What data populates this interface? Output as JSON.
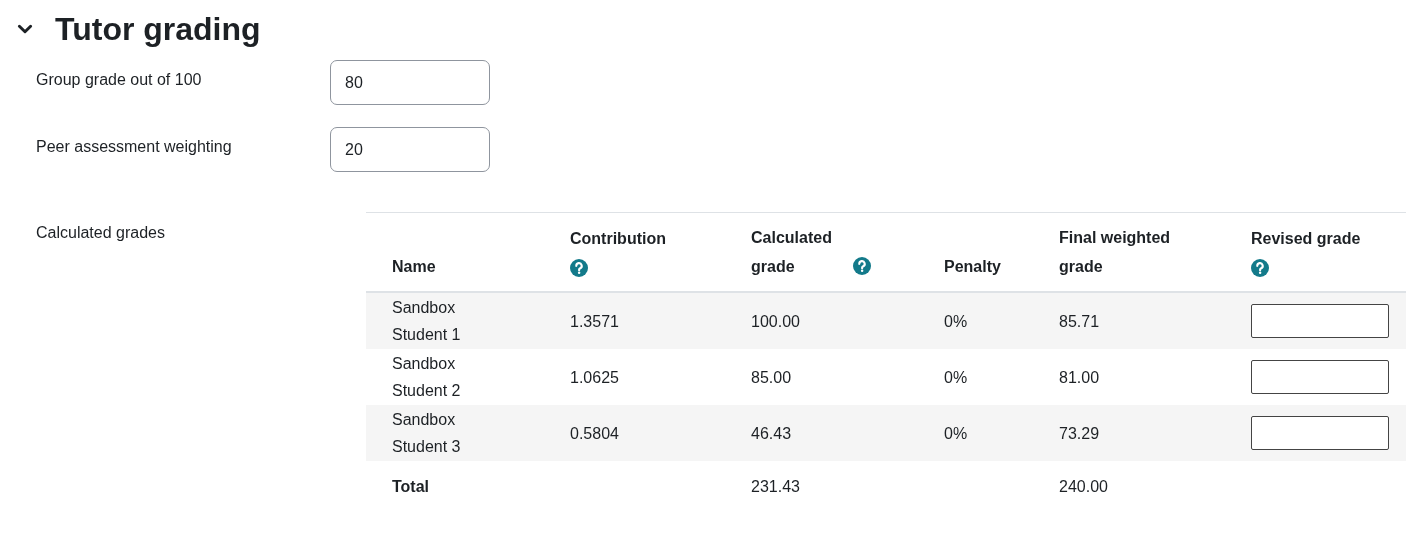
{
  "section": {
    "title": "Tutor grading",
    "expanded": true
  },
  "fields": [
    {
      "label": "Group grade out of 100",
      "value": "80"
    },
    {
      "label": "Peer assessment weighting",
      "value": "20"
    }
  ],
  "grades": {
    "label": "Calculated grades",
    "columns": [
      {
        "label": "Name",
        "help": false
      },
      {
        "label": "Contribution",
        "help": true
      },
      {
        "label": "Calculated grade",
        "help": true
      },
      {
        "label": "Penalty",
        "help": false
      },
      {
        "label": "Final weighted grade",
        "help": false
      },
      {
        "label": "Revised grade",
        "help": true
      }
    ],
    "rows": [
      {
        "name": "Sandbox Student 1",
        "contribution": "1.3571",
        "calculated": "100.00",
        "penalty": "0%",
        "final": "85.71"
      },
      {
        "name": "Sandbox Student 2",
        "contribution": "1.0625",
        "calculated": "85.00",
        "penalty": "0%",
        "final": "81.00"
      },
      {
        "name": "Sandbox Student 3",
        "contribution": "0.5804",
        "calculated": "46.43",
        "penalty": "0%",
        "final": "73.29"
      }
    ],
    "total": {
      "label": "Total",
      "calculated": "231.43",
      "final": "240.00"
    }
  }
}
